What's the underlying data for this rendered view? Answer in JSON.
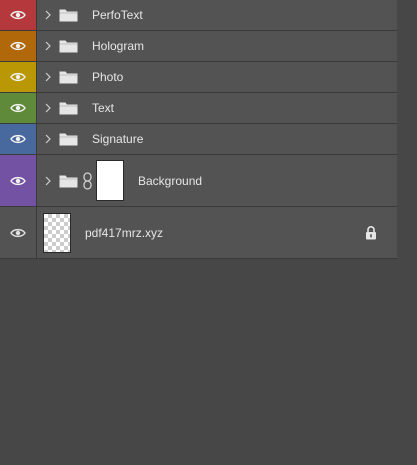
{
  "layers": [
    {
      "name": "PerfoText",
      "color": "#b5393c",
      "type": "group"
    },
    {
      "name": "Hologram",
      "color": "#b0680a",
      "type": "group"
    },
    {
      "name": "Photo",
      "color": "#b99705",
      "type": "group"
    },
    {
      "name": "Text",
      "color": "#5f8a39",
      "type": "group"
    },
    {
      "name": "Signature",
      "color": "#48699d",
      "type": "group"
    },
    {
      "name": "Background",
      "color": "#7352a3",
      "type": "group-with-mask"
    },
    {
      "name": "pdf417mrz.xyz",
      "color": "#535353",
      "type": "smart-layer",
      "locked": true
    }
  ],
  "icons": {
    "visibility": "eye-icon",
    "expand": "chevron-right-icon",
    "group": "folder-icon",
    "mask_link": "chain-link-icon",
    "lock": "lock-icon"
  },
  "colors": {
    "panel_bg": "#474747",
    "row_bg": "#535353",
    "text": "#e6e6e6"
  }
}
